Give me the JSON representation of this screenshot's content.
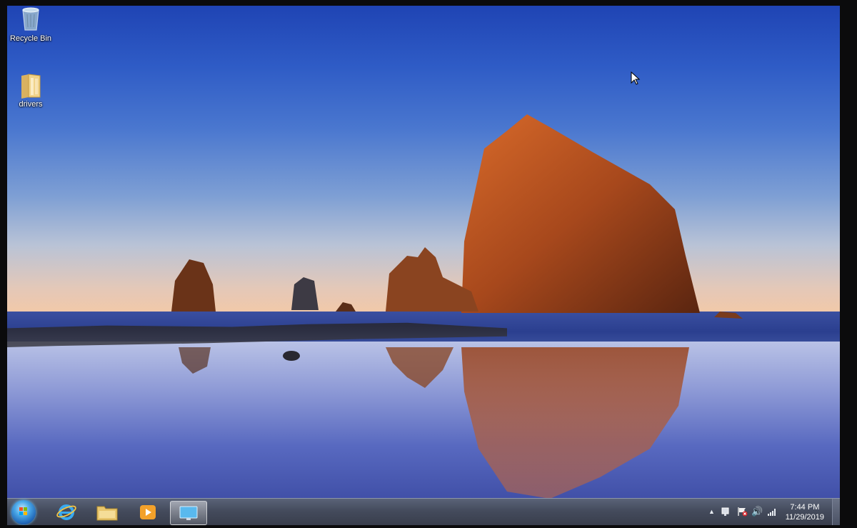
{
  "desktop": {
    "icons": [
      {
        "label": "Recycle Bin",
        "icon": "recycle-bin-icon"
      },
      {
        "label": "drivers",
        "icon": "folder-icon"
      }
    ]
  },
  "taskbar": {
    "pinned": [
      {
        "name": "Internet Explorer",
        "icon": "internet-explorer-icon"
      },
      {
        "name": "Windows Explorer",
        "icon": "folder-icon"
      },
      {
        "name": "Windows Media Player",
        "icon": "media-player-icon"
      },
      {
        "name": "Active window",
        "icon": "display-icon",
        "active": true
      }
    ],
    "tray": {
      "icons": [
        "show-hidden-icons-arrow",
        "network-icon",
        "action-center-flag-icon",
        "volume-icon",
        "signal-icon"
      ]
    },
    "clock": {
      "time": "7:44 PM",
      "date": "11/29/2019"
    }
  },
  "colors": {
    "taskbar": "#444b5c",
    "sky_top": "#1f44b4",
    "horizon": "#f2c9a8",
    "rock": "#a84a20"
  }
}
